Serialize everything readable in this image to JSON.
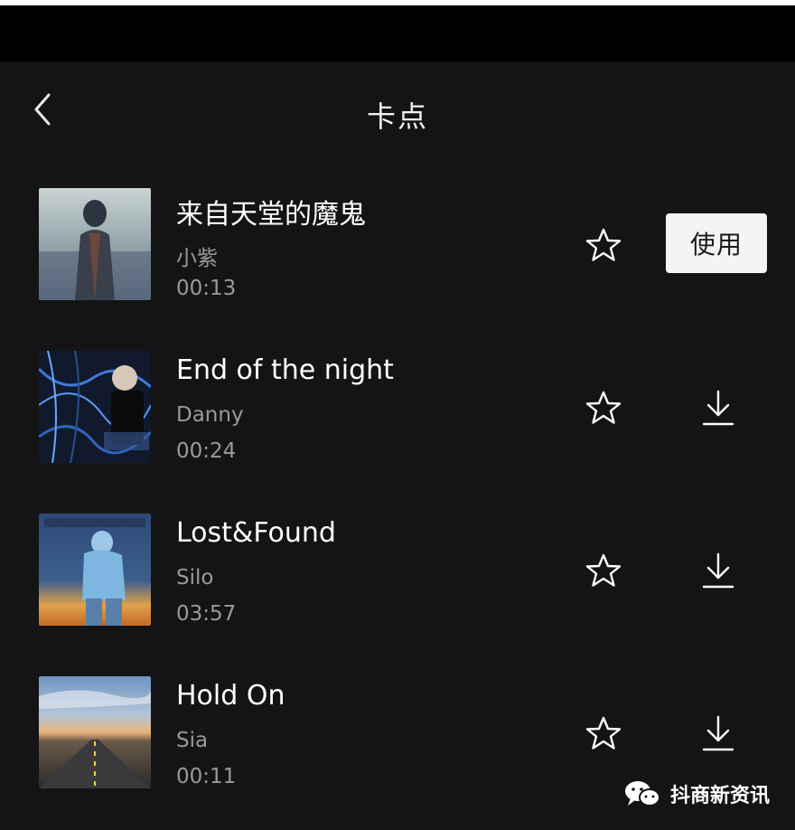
{
  "header": {
    "title": "卡点",
    "back_icon": "chevron-left-icon"
  },
  "songs": [
    {
      "title": "来自天堂的魔鬼",
      "artist": "小紫",
      "duration": "00:13",
      "action": "使用",
      "selected": true
    },
    {
      "title": "End of the night",
      "artist": "Danny",
      "duration": "00:24",
      "action_icon": "download-icon",
      "selected": false
    },
    {
      "title": "Lost&Found",
      "artist": "Silo",
      "duration": "03:57",
      "action_icon": "download-icon",
      "selected": false
    },
    {
      "title": "Hold On",
      "artist": "Sia",
      "duration": "00:11",
      "action_icon": "download-icon",
      "selected": false
    }
  ],
  "watermark": {
    "text": "抖商新资讯",
    "icon": "wechat-icon"
  },
  "colors": {
    "background": "#141416",
    "status_bar": "#000000",
    "primary_text": "#ffffff",
    "secondary_text": "#9a9a9a",
    "use_button_bg": "#f4f4f4",
    "use_button_text": "#1a1a1a"
  }
}
